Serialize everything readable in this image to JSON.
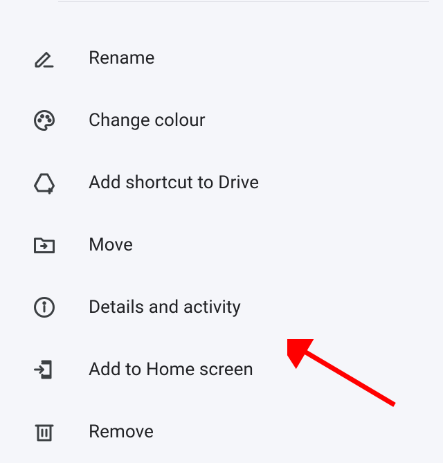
{
  "menu": {
    "items": [
      {
        "label": "Rename"
      },
      {
        "label": "Change colour"
      },
      {
        "label": "Add shortcut to Drive"
      },
      {
        "label": "Move"
      },
      {
        "label": "Details and activity"
      },
      {
        "label": "Add to Home screen"
      },
      {
        "label": "Remove"
      }
    ]
  },
  "annotation": {
    "arrow_color": "#ff0000"
  }
}
